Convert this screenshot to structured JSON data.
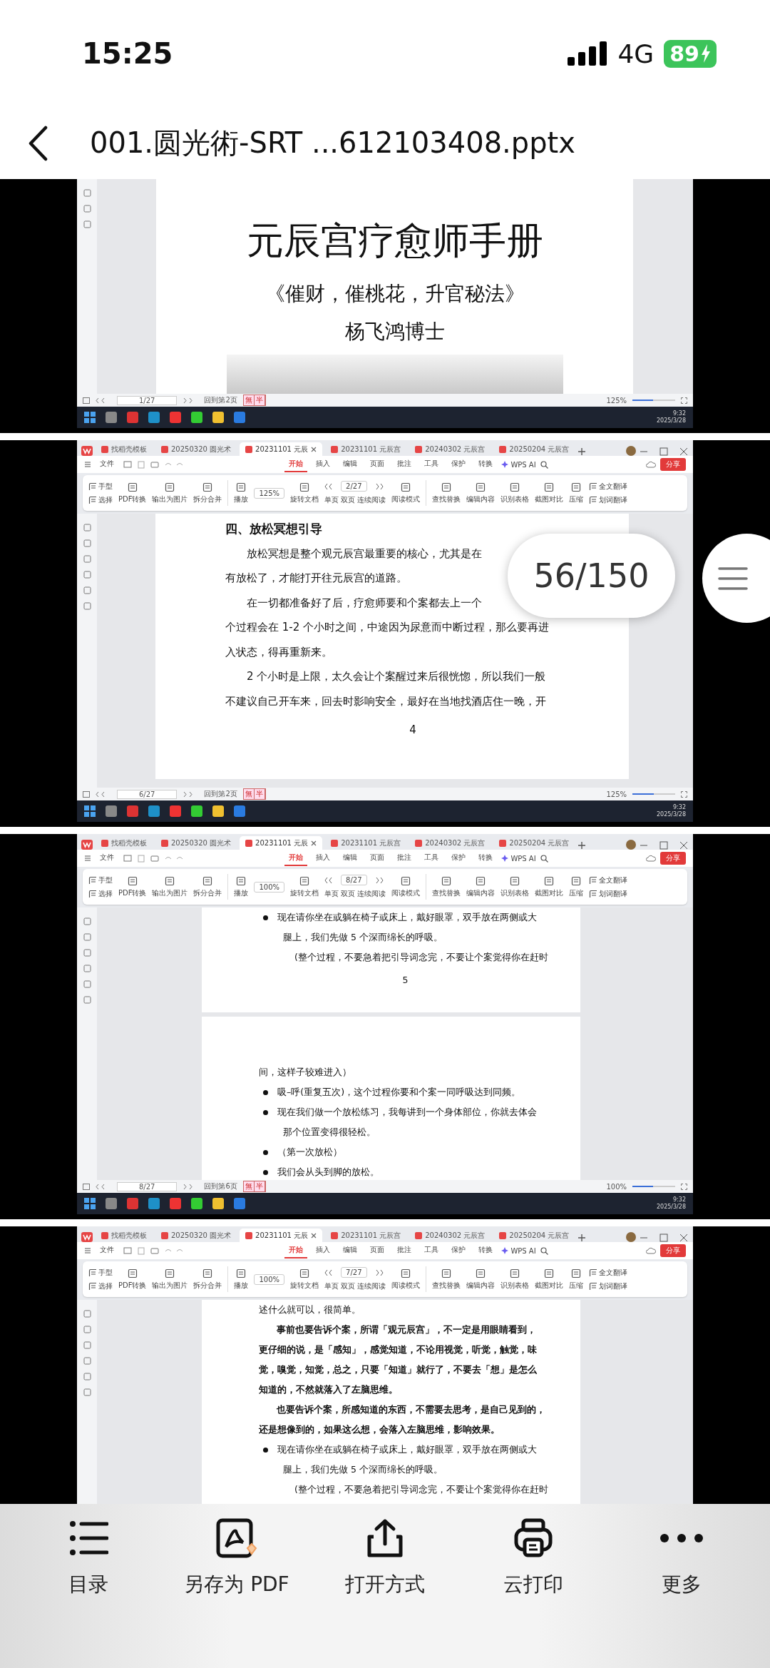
{
  "status_bar": {
    "time": "15:25",
    "network": "4G",
    "battery": "89"
  },
  "header": {
    "title": "001.圆光術-SRT ...612103408.pptx"
  },
  "viewer": {
    "page_indicator": "56/150"
  },
  "slides": [
    {
      "kind": "cover",
      "status": {
        "page": "1/27",
        "back_label": "回到第2页",
        "ime": [
          "無",
          "半"
        ],
        "zoom": "125%",
        "slider": {
          "level": 0.48
        }
      },
      "tray": {
        "time": "9:32",
        "date": "2025/3/28"
      },
      "pages": [
        {
          "blocks": [
            {
              "kind": "title",
              "text": "元辰宫疗愈师手册"
            },
            {
              "kind": "subtitle",
              "text": "《催财，催桃花，升官秘法》"
            },
            {
              "kind": "author",
              "text": "杨飞鸿博士"
            },
            {
              "kind": "image"
            }
          ]
        }
      ]
    },
    {
      "kind": "wide",
      "tabs": [
        {
          "label": "找稻壳模板",
          "selected": false
        },
        {
          "label": "20250320 圆光术",
          "selected": false
        },
        {
          "label": "20231101 元辰",
          "selected": true
        },
        {
          "label": "20231101 元辰宫",
          "selected": false
        },
        {
          "label": "20240302 元辰宫",
          "selected": false
        },
        {
          "label": "20250204 元辰宫",
          "selected": false
        }
      ],
      "menu": {
        "file": "文件",
        "items": [
          {
            "label": "开始",
            "selected": true
          },
          {
            "label": "插入",
            "selected": false
          },
          {
            "label": "编辑",
            "selected": false
          },
          {
            "label": "页面",
            "selected": false
          },
          {
            "label": "批注",
            "selected": false
          },
          {
            "label": "工具",
            "selected": false
          },
          {
            "label": "保护",
            "selected": false
          },
          {
            "label": "转换",
            "selected": false
          }
        ],
        "ai": "WPS AI",
        "share": "分享"
      },
      "ribbon": {
        "hand": "手型",
        "select": "选择",
        "items": [
          "PDF转换",
          "输出为图片",
          "拆分合并",
          "播放",
          "旋转文档"
        ],
        "zoom": "125%",
        "page": "2/27",
        "views": [
          "单页",
          "双页",
          "连续阅读"
        ],
        "read": "阅读模式",
        "tools": [
          "查找替换",
          "编辑内容",
          "识别表格",
          "截图对比",
          "压缩"
        ],
        "translate": [
          "全文翻译",
          "划词翻译"
        ]
      },
      "status": {
        "page": "6/27",
        "back_label": "回到第2页",
        "ime": [
          "無",
          "半"
        ],
        "zoom": "125%",
        "slider": {
          "level": 0.5
        }
      },
      "tray": {
        "time": "9:32",
        "date": "2025/3/28"
      },
      "pages": [
        {
          "blocks": [
            {
              "kind": "heading",
              "text": "四、放松冥想引导"
            },
            {
              "kind": "indent",
              "text": "放松冥想是整个观元辰宫最重要的核心，尤其是在"
            },
            {
              "kind": "line",
              "text": "有放松了，才能打开往元辰宫的道路。"
            },
            {
              "kind": "indent",
              "text": "在一切都准备好了后，疗愈师要和个案都去上一个"
            },
            {
              "kind": "line",
              "text": "个过程会在 1-2 个小时之间，中途因为尿意而中断过程，那么要再进"
            },
            {
              "kind": "line",
              "text": "入状态，得再重新来。"
            },
            {
              "kind": "indent",
              "text": "2 个小时是上限，太久会让个案醒过来后很恍惚，所以我们一般"
            },
            {
              "kind": "line",
              "text": "不建议自己开车来，回去时影响安全，最好在当地找酒店住一晚，开"
            },
            {
              "kind": "pagenum",
              "text": "4"
            }
          ]
        }
      ]
    },
    {
      "kind": "narrow",
      "tabs": [
        {
          "label": "找稻壳模板",
          "selected": false
        },
        {
          "label": "20250320 圆光术",
          "selected": false
        },
        {
          "label": "20231101 元辰",
          "selected": true
        },
        {
          "label": "20231101 元辰宫",
          "selected": false
        },
        {
          "label": "20240302 元辰宫",
          "selected": false
        },
        {
          "label": "20250204 元辰宫",
          "selected": false
        }
      ],
      "menu": {
        "file": "文件",
        "items": [
          {
            "label": "开始",
            "selected": true
          },
          {
            "label": "插入",
            "selected": false
          },
          {
            "label": "编辑",
            "selected": false
          },
          {
            "label": "页面",
            "selected": false
          },
          {
            "label": "批注",
            "selected": false
          },
          {
            "label": "工具",
            "selected": false
          },
          {
            "label": "保护",
            "selected": false
          },
          {
            "label": "转换",
            "selected": false
          }
        ],
        "ai": "WPS AI",
        "share": "分享"
      },
      "ribbon": {
        "hand": "手型",
        "select": "选择",
        "items": [
          "PDF转换",
          "输出为图片",
          "拆分合并",
          "播放",
          "旋转文档"
        ],
        "zoom": "100%",
        "page": "8/27",
        "views": [
          "单页",
          "双页",
          "连续阅读"
        ],
        "read": "阅读模式",
        "tools": [
          "查找替换",
          "编辑内容",
          "识别表格",
          "截图对比",
          "压缩"
        ],
        "translate": [
          "全文翻译",
          "划词翻译"
        ]
      },
      "status": {
        "page": "8/27",
        "back_label": "回到第6页",
        "ime": [
          "無",
          "半"
        ],
        "zoom": "100%",
        "slider": {
          "level": 0.48
        }
      },
      "tray": {
        "time": "9:32",
        "date": "2025/3/28"
      },
      "pages": [
        {
          "blocks": [
            {
              "kind": "bullet",
              "text": "现在请你坐在或躺在椅子或床上，戴好眼罩，双手放在两侧或大"
            },
            {
              "kind": "cont",
              "text": "腿上，我们先做 5 个深而绵长的呼吸。"
            },
            {
              "kind": "note",
              "text": "(整个过程，不要急着把引导词念完，不要让个案觉得你在赶时"
            },
            {
              "kind": "pagenum",
              "text": "5"
            }
          ]
        },
        {
          "blocks": [
            {
              "kind": "line",
              "text": "间，这样子较难进入）"
            },
            {
              "kind": "bullet",
              "text": "吸–呼(重复五次)，这个过程你要和个案一同呼吸达到同频。"
            },
            {
              "kind": "bullet",
              "text": "现在我们做一个放松练习，我每讲到一个身体部位，你就去体会"
            },
            {
              "kind": "cont",
              "text": "那个位置变得很轻松。"
            },
            {
              "kind": "bullet",
              "text": "（第一次放松）"
            },
            {
              "kind": "bullet",
              "text": "我们会从头到脚的放松。"
            }
          ]
        }
      ]
    },
    {
      "kind": "narrow",
      "tabs": [
        {
          "label": "找稻壳模板",
          "selected": false
        },
        {
          "label": "20250320 圆光术",
          "selected": false
        },
        {
          "label": "20231101 元辰",
          "selected": true
        },
        {
          "label": "20231101 元辰宫",
          "selected": false
        },
        {
          "label": "20240302 元辰宫",
          "selected": false
        },
        {
          "label": "20250204 元辰宫",
          "selected": false
        }
      ],
      "menu": {
        "file": "文件",
        "items": [
          {
            "label": "开始",
            "selected": true
          },
          {
            "label": "插入",
            "selected": false
          },
          {
            "label": "编辑",
            "selected": false
          },
          {
            "label": "页面",
            "selected": false
          },
          {
            "label": "批注",
            "selected": false
          },
          {
            "label": "工具",
            "selected": false
          },
          {
            "label": "保护",
            "selected": false
          },
          {
            "label": "转换",
            "selected": false
          }
        ],
        "ai": "WPS AI",
        "share": "分享"
      },
      "ribbon": {
        "hand": "手型",
        "select": "选择",
        "items": [
          "PDF转换",
          "输出为图片",
          "拆分合并",
          "播放",
          "旋转文档"
        ],
        "zoom": "100%",
        "page": "7/27",
        "views": [
          "单页",
          "双页",
          "连续阅读"
        ],
        "read": "阅读模式",
        "tools": [
          "查找替换",
          "编辑内容",
          "识别表格",
          "截图对比",
          "压缩"
        ],
        "translate": [
          "全文翻译",
          "划词翻译"
        ]
      },
      "pages": [
        {
          "blocks": [
            {
              "kind": "line",
              "text": "述什么就可以，很简单。"
            },
            {
              "kind": "bold-indent",
              "text": "事前也要告诉个案，所谓「观元辰宫」，不一定是用眼睛看到，"
            },
            {
              "kind": "bold",
              "text": "更仔细的说，是「感知」，感觉知道，不论用视觉，听觉，触觉，味"
            },
            {
              "kind": "bold",
              "text": "觉，嗅觉，知觉，总之，只要「知道」就行了，不要去「想」是怎么"
            },
            {
              "kind": "bold",
              "text": "知道的，不然就落入了左脑思维。"
            },
            {
              "kind": "bold-indent",
              "text": "也要告诉个案，所感知道的东西，不需要去思考，是自己见到的，"
            },
            {
              "kind": "bold",
              "text": "还是想像到的，如果这么想，会落入左脑思维，影响效果。"
            },
            {
              "kind": "bullet",
              "text": "现在请你坐在或躺在椅子或床上，戴好眼罩，双手放在两侧或大"
            },
            {
              "kind": "cont",
              "text": "腿上，我们先做 5 个深而绵长的呼吸。"
            },
            {
              "kind": "note",
              "text": "(整个过程，不要急着把引导词念完，不要让个案觉得你在赶时"
            }
          ]
        }
      ]
    }
  ],
  "toolbar": [
    {
      "label": "目录"
    },
    {
      "label": "另存为 PDF"
    },
    {
      "label": "打开方式"
    },
    {
      "label": "云打印"
    },
    {
      "label": "更多"
    }
  ]
}
